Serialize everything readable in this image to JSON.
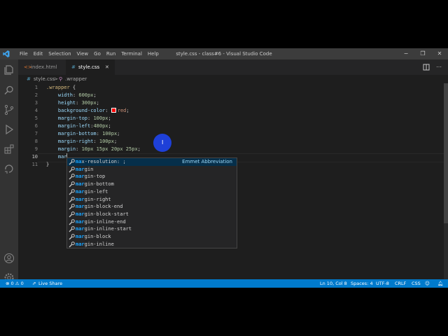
{
  "titlebar": {
    "menu": [
      "File",
      "Edit",
      "Selection",
      "View",
      "Go",
      "Run",
      "Terminal",
      "Help"
    ],
    "window_title": "style.css - class#6 - Visual Studio Code",
    "controls": [
      "−",
      "❐",
      "✕"
    ]
  },
  "tabs": [
    {
      "label": "index.html",
      "icon": "html-file-icon",
      "active": false
    },
    {
      "label": "style.css",
      "icon": "css-file-icon",
      "active": true,
      "close": "✕"
    }
  ],
  "breadcrumb": {
    "file": "style.css",
    "sep": ">",
    "symbol": ".wrapper"
  },
  "editor": {
    "line_numbers": [
      "1",
      "2",
      "3",
      "4",
      "5",
      "6",
      "7",
      "8",
      "9",
      "10",
      "11"
    ],
    "lines": [
      {
        "parts": [
          {
            "t": ".wrapper",
            "c": "sel"
          },
          {
            "t": " {",
            "c": "punc"
          }
        ]
      },
      {
        "parts": [
          {
            "t": "    width",
            "c": "prop"
          },
          {
            "t": ": ",
            "c": "punc"
          },
          {
            "t": "600px",
            "c": "num"
          },
          {
            "t": ";",
            "c": "punc"
          }
        ]
      },
      {
        "parts": [
          {
            "t": "    height",
            "c": "prop"
          },
          {
            "t": ": ",
            "c": "punc"
          },
          {
            "t": "300px",
            "c": "num"
          },
          {
            "t": ";",
            "c": "punc"
          }
        ]
      },
      {
        "parts": [
          {
            "t": "    background-color",
            "c": "prop"
          },
          {
            "t": ": ",
            "c": "punc"
          },
          {
            "t": "",
            "c": "swatch"
          },
          {
            "t": "red",
            "c": "val"
          },
          {
            "t": ";",
            "c": "punc"
          }
        ]
      },
      {
        "parts": [
          {
            "t": "    margin-top",
            "c": "prop"
          },
          {
            "t": ": ",
            "c": "punc"
          },
          {
            "t": "100px",
            "c": "num"
          },
          {
            "t": ";",
            "c": "punc"
          }
        ]
      },
      {
        "parts": [
          {
            "t": "    margin-left",
            "c": "prop"
          },
          {
            "t": ":",
            "c": "punc"
          },
          {
            "t": "480px",
            "c": "num"
          },
          {
            "t": ";",
            "c": "punc"
          }
        ]
      },
      {
        "parts": [
          {
            "t": "    margin-bottom",
            "c": "prop"
          },
          {
            "t": ": ",
            "c": "punc"
          },
          {
            "t": "100px",
            "c": "num"
          },
          {
            "t": ";",
            "c": "punc"
          }
        ]
      },
      {
        "parts": [
          {
            "t": "    margin-right",
            "c": "prop"
          },
          {
            "t": ": ",
            "c": "punc"
          },
          {
            "t": "100px",
            "c": "num"
          },
          {
            "t": ";",
            "c": "punc"
          }
        ]
      },
      {
        "parts": [
          {
            "t": "    margin",
            "c": "prop"
          },
          {
            "t": ": ",
            "c": "punc"
          },
          {
            "t": "10px 15px 20px 25px",
            "c": "num"
          },
          {
            "t": ";",
            "c": "punc"
          }
        ]
      },
      {
        "parts": [
          {
            "t": "    mar",
            "c": "prop"
          }
        ]
      },
      {
        "parts": [
          {
            "t": "}",
            "c": "punc"
          }
        ]
      }
    ]
  },
  "suggest": {
    "items": [
      {
        "match": "ma",
        "rest": "x-resolution: ;",
        "detail": "Emmet Abbreviation"
      },
      {
        "match": "mar",
        "rest": "gin"
      },
      {
        "match": "mar",
        "rest": "gin-top"
      },
      {
        "match": "mar",
        "rest": "gin-bottom"
      },
      {
        "match": "mar",
        "rest": "gin-left"
      },
      {
        "match": "mar",
        "rest": "gin-right"
      },
      {
        "match": "mar",
        "rest": "gin-block-end"
      },
      {
        "match": "mar",
        "rest": "gin-block-start"
      },
      {
        "match": "mar",
        "rest": "gin-inline-end"
      },
      {
        "match": "mar",
        "rest": "gin-inline-start"
      },
      {
        "match": "mar",
        "rest": "gin-block"
      },
      {
        "match": "mar",
        "rest": "gin-inline"
      }
    ]
  },
  "status": {
    "problems": "⊗ 0 ⚠ 0",
    "live_share": "Live Share",
    "position": "Ln 10, Col 8",
    "spaces": "Spaces: 4",
    "encoding": "UTF-8",
    "eol": "CRLF",
    "language": "CSS"
  },
  "colors": {
    "accent": "#007acc",
    "click_indicator": "#1e40d8",
    "swatch": "#ff0000"
  }
}
